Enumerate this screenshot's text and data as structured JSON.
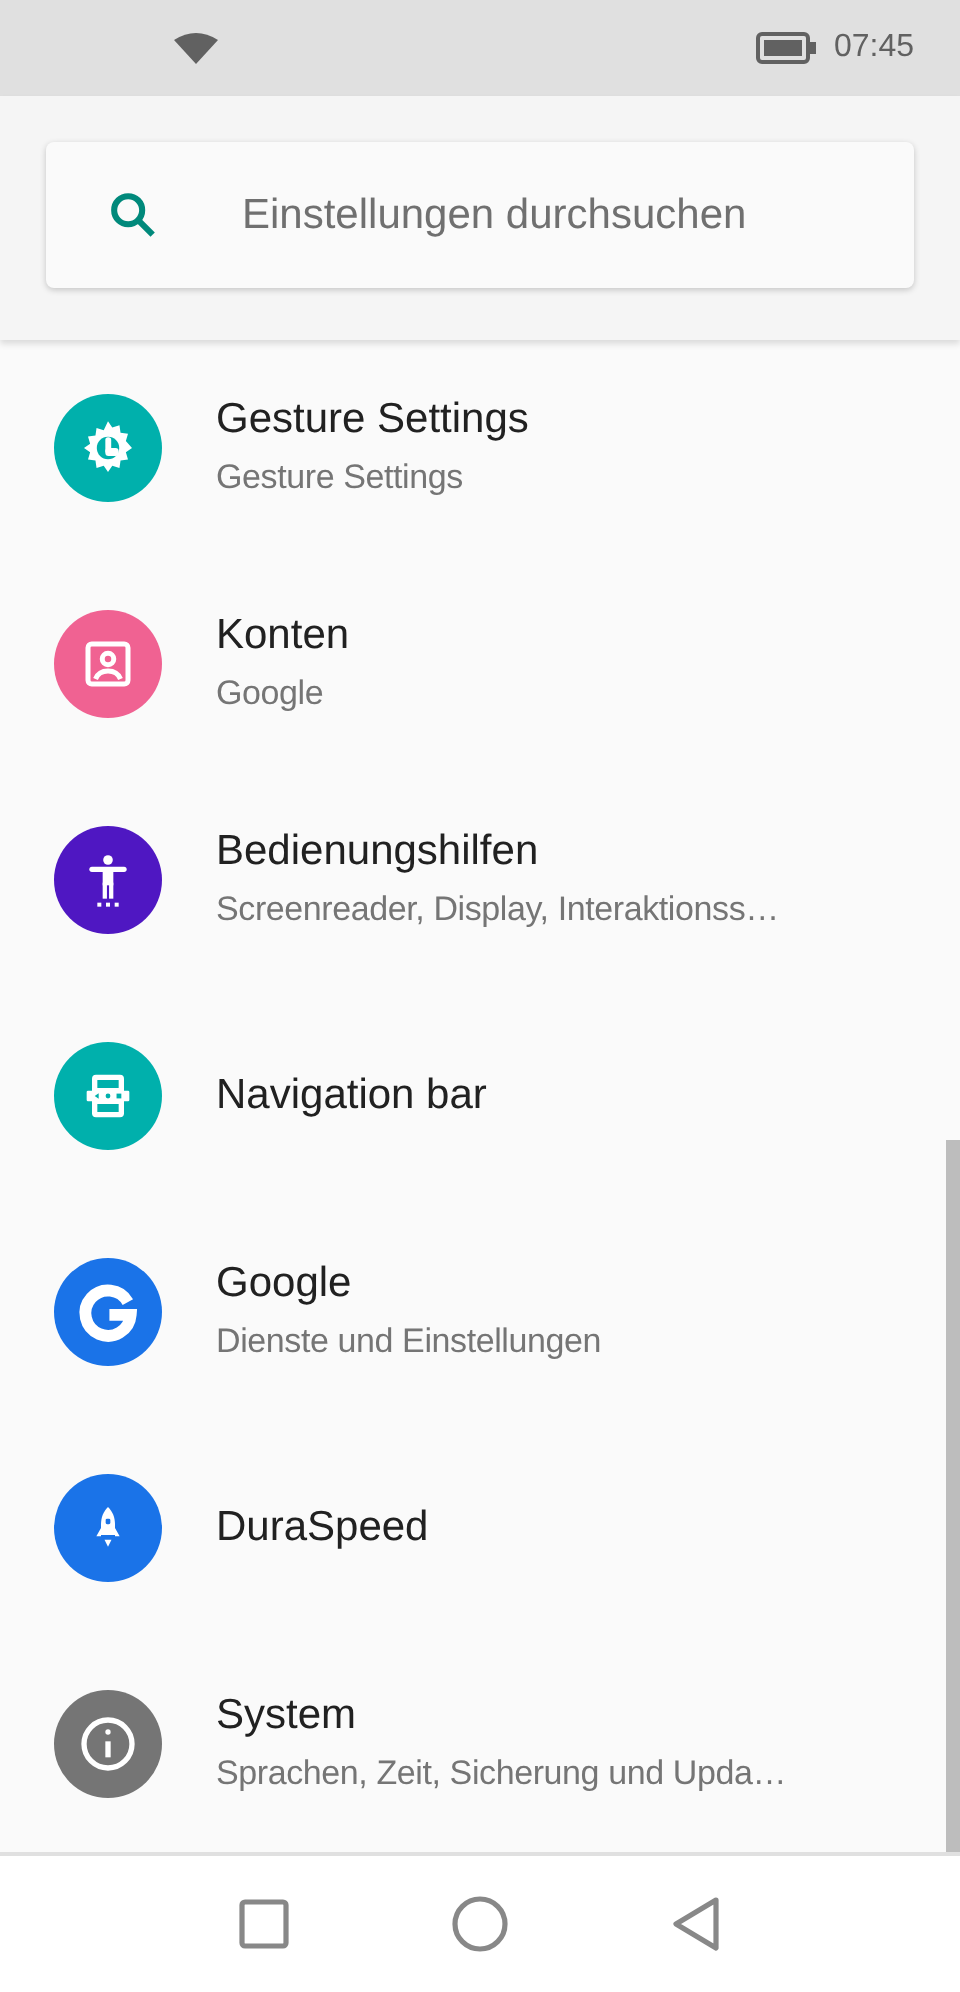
{
  "status_bar": {
    "time": "07:45"
  },
  "search": {
    "placeholder": "Einstellungen durchsuchen"
  },
  "items": [
    {
      "kind": "gesture",
      "color": "#00b0ac",
      "title": "Gesture Settings",
      "subtitle": "Gesture Settings"
    },
    {
      "kind": "account",
      "color": "#f06292",
      "title": "Konten",
      "subtitle": "Google"
    },
    {
      "kind": "accessibility",
      "color": "#4f17c2",
      "title": "Bedienungshilfen",
      "subtitle": "Screenreader, Display, Interaktionss…"
    },
    {
      "kind": "navigation",
      "color": "#00b0ac",
      "title": "Navigation bar"
    },
    {
      "kind": "google",
      "color": "#1a73e8",
      "title": "Google",
      "subtitle": "Dienste und Einstellungen"
    },
    {
      "kind": "rocket",
      "color": "#1a73e8",
      "title": "DuraSpeed"
    },
    {
      "kind": "info",
      "color": "#757575",
      "title": "System",
      "subtitle": "Sprachen, Zeit, Sicherung und Upda…"
    }
  ]
}
